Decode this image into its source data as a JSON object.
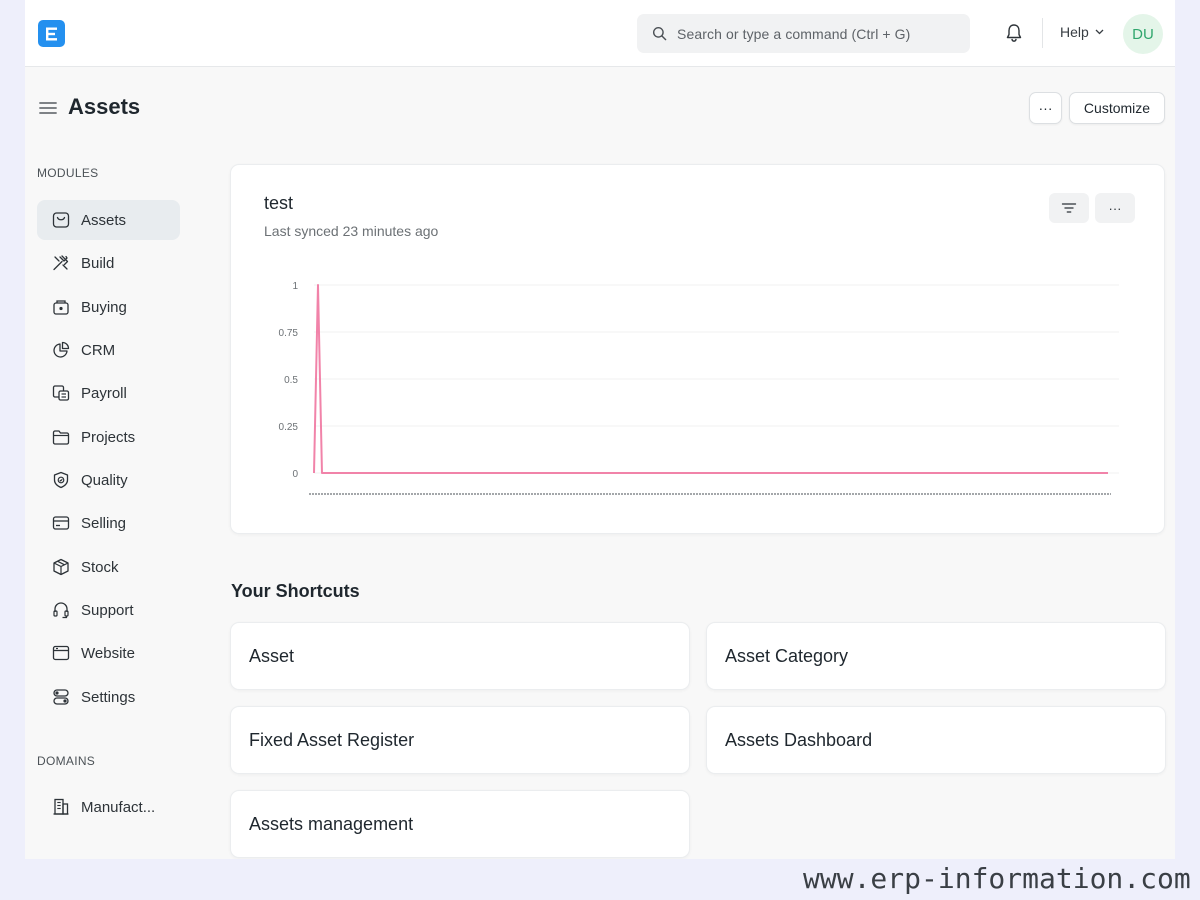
{
  "navbar": {
    "logo_letter": "E",
    "search_placeholder": "Search or type a command (Ctrl + G)",
    "help_label": "Help",
    "avatar_initials": "DU"
  },
  "page": {
    "title": "Assets",
    "more_label": "···",
    "customize_label": "Customize"
  },
  "sidebar": {
    "modules_label": "MODULES",
    "items": [
      {
        "label": "Assets",
        "icon": "assets-icon",
        "active": true
      },
      {
        "label": "Build",
        "icon": "build-icon"
      },
      {
        "label": "Buying",
        "icon": "buying-icon"
      },
      {
        "label": "CRM",
        "icon": "crm-icon"
      },
      {
        "label": "Payroll",
        "icon": "payroll-icon"
      },
      {
        "label": "Projects",
        "icon": "projects-icon"
      },
      {
        "label": "Quality",
        "icon": "quality-icon"
      },
      {
        "label": "Selling",
        "icon": "selling-icon"
      },
      {
        "label": "Stock",
        "icon": "stock-icon"
      },
      {
        "label": "Support",
        "icon": "support-icon"
      },
      {
        "label": "Website",
        "icon": "website-icon"
      },
      {
        "label": "Settings",
        "icon": "settings-icon"
      }
    ],
    "domains_label": "DOMAINS",
    "domains": [
      {
        "label": "Manufact...",
        "icon": "manufacturing-icon"
      }
    ]
  },
  "chart_card": {
    "title": "test",
    "subtitle": "Last synced 23 minutes ago",
    "more_label": "···"
  },
  "chart_data": {
    "type": "line",
    "y_ticks": [
      "1",
      "0.75",
      "0.5",
      "0.25",
      "0"
    ],
    "ylim": [
      0,
      1
    ],
    "grid": true,
    "color": "#f183a9",
    "series": [
      {
        "values": [
          0,
          1,
          0,
          0,
          0,
          0,
          0,
          0,
          0,
          0,
          0,
          0,
          0,
          0,
          0,
          0,
          0,
          0,
          0,
          0,
          0,
          0,
          0,
          0,
          0,
          0,
          0,
          0,
          0,
          0,
          0,
          0,
          0,
          0,
          0,
          0,
          0,
          0,
          0,
          0,
          0,
          0,
          0,
          0,
          0,
          0,
          0,
          0,
          0,
          0,
          0,
          0,
          0,
          0,
          0,
          0,
          0,
          0,
          0,
          0,
          0,
          0,
          0,
          0,
          0,
          0,
          0,
          0,
          0,
          0,
          0,
          0,
          0,
          0,
          0,
          0,
          0,
          0,
          0,
          0,
          0,
          0,
          0,
          0,
          0,
          0,
          0,
          0,
          0,
          0,
          0,
          0,
          0,
          0,
          0,
          0,
          0,
          0,
          0,
          0,
          0,
          0,
          0,
          0,
          0,
          0,
          0,
          0,
          0,
          0,
          0,
          0,
          0,
          0,
          0,
          0,
          0,
          0,
          0,
          0,
          0,
          0,
          0,
          0,
          0,
          0,
          0,
          0,
          0,
          0,
          0,
          0,
          0,
          0,
          0,
          0,
          0,
          0,
          0,
          0,
          0,
          0,
          0,
          0,
          0,
          0,
          0,
          0,
          0,
          0,
          0,
          0,
          0,
          0,
          0,
          0,
          0,
          0,
          0,
          0,
          0,
          0,
          0,
          0,
          0,
          0,
          0,
          0,
          0,
          0,
          0,
          0,
          0,
          0,
          0,
          0,
          0,
          0,
          0,
          0,
          0,
          0,
          0,
          0,
          0,
          0,
          0,
          0,
          0,
          0,
          0,
          0,
          0,
          0,
          0,
          0,
          0,
          0,
          0,
          0
        ]
      }
    ]
  },
  "shortcuts": {
    "title": "Your Shortcuts",
    "items": [
      "Asset",
      "Asset Category",
      "Fixed Asset Register",
      "Assets Dashboard",
      "Assets management"
    ]
  },
  "watermark": "www.erp-information.com"
}
